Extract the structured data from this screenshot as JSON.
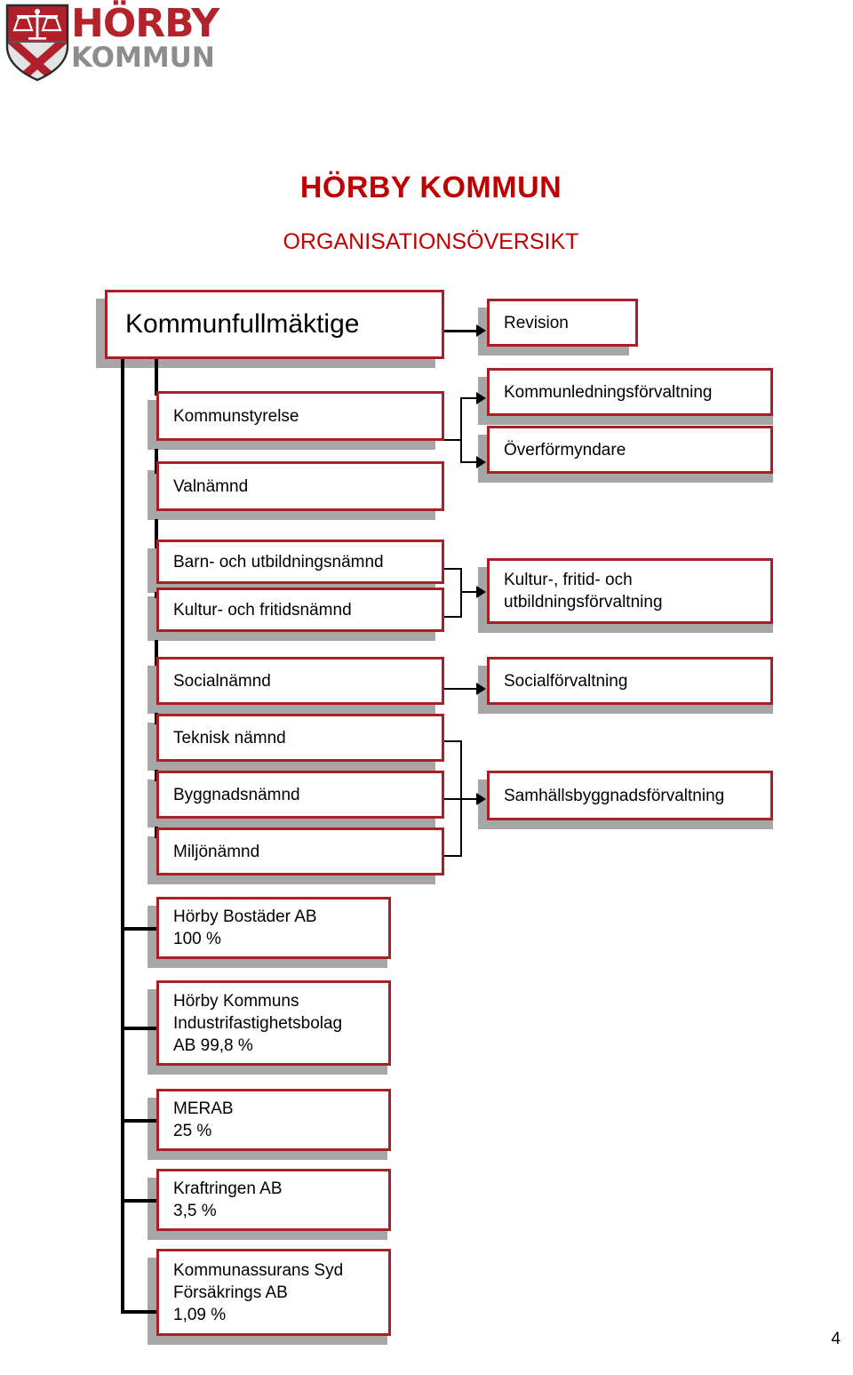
{
  "logo": {
    "name_top": "HÖRBY",
    "name_bottom": "KOMMUN",
    "icon": "coat-of-arms-shield-icon"
  },
  "header": {
    "title": "HÖRBY KOMMUN",
    "subtitle": "ORGANISATIONSÖVERSIKT"
  },
  "page": {
    "number": "4"
  },
  "colors": {
    "brand_red": "#c00000",
    "border_red": "#a81f26",
    "shadow_gray": "#a6a6a6",
    "logo_gray": "#8d8d8d"
  },
  "chart_data": {
    "type": "diagram",
    "title": "HÖRBY KOMMUN ORGANISATIONSÖVERSIKT",
    "nodes": [
      {
        "id": "kf",
        "label": "Kommunfullmäktige",
        "column": "left",
        "level": 0
      },
      {
        "id": "rev",
        "label": "Revision",
        "column": "right",
        "level": 0
      },
      {
        "id": "ks",
        "label": "Kommunstyrelse",
        "column": "left",
        "level": 1
      },
      {
        "id": "klf",
        "label": "Kommunledningsförvaltning",
        "column": "right",
        "level": 1
      },
      {
        "id": "ofm",
        "label": "Överförmyndare",
        "column": "right",
        "level": 1
      },
      {
        "id": "valn",
        "label": "Valnämnd",
        "column": "left",
        "level": 2
      },
      {
        "id": "bun",
        "label": "Barn- och utbildningsnämnd",
        "column": "left",
        "level": 3
      },
      {
        "id": "kfn",
        "label": "Kultur- och fritidsnämnd",
        "column": "left",
        "level": 4
      },
      {
        "id": "kfuf",
        "label": "Kultur-, fritid- och utbildningsförvaltning",
        "column": "right",
        "level": 3
      },
      {
        "id": "socn",
        "label": "Socialnämnd",
        "column": "left",
        "level": 5
      },
      {
        "id": "socf",
        "label": "Socialförvaltning",
        "column": "right",
        "level": 5
      },
      {
        "id": "tekn",
        "label": "Teknisk nämnd",
        "column": "left",
        "level": 6
      },
      {
        "id": "bygg",
        "label": "Byggnadsnämnd",
        "column": "left",
        "level": 7
      },
      {
        "id": "miljo",
        "label": "Miljönämnd",
        "column": "left",
        "level": 8
      },
      {
        "id": "sbf",
        "label": "Samhällsbyggnadsförvaltning",
        "column": "right",
        "level": 7
      },
      {
        "id": "hba",
        "label": "Hörby Bostäder AB\n100 %",
        "column": "sub",
        "level": 9
      },
      {
        "id": "hkif",
        "label": "Hörby Kommuns\nIndustrifastighetsbolag\nAB 99,8 %",
        "column": "sub",
        "level": 10
      },
      {
        "id": "merab",
        "label": "MERAB\n25 %",
        "column": "sub",
        "level": 11
      },
      {
        "id": "kraft",
        "label": "Kraftringen AB\n3,5 %",
        "column": "sub",
        "level": 12
      },
      {
        "id": "kass",
        "label": "Kommunassurans Syd\nFörsäkrings AB\n1,09 %",
        "column": "sub",
        "level": 13
      }
    ],
    "edges": [
      {
        "from": "kf",
        "to": "rev",
        "arrow": true
      },
      {
        "from": "kf",
        "to": "ks",
        "arrow": false
      },
      {
        "from": "kf",
        "to": "valn",
        "arrow": false
      },
      {
        "from": "kf",
        "to": "bun",
        "arrow": false
      },
      {
        "from": "kf",
        "to": "kfn",
        "arrow": false
      },
      {
        "from": "kf",
        "to": "socn",
        "arrow": false
      },
      {
        "from": "kf",
        "to": "tekn",
        "arrow": false
      },
      {
        "from": "kf",
        "to": "bygg",
        "arrow": false
      },
      {
        "from": "kf",
        "to": "miljo",
        "arrow": false
      },
      {
        "from": "ks",
        "to": "klf",
        "arrow": true
      },
      {
        "from": "ks",
        "to": "ofm",
        "arrow": true
      },
      {
        "from": "bun",
        "to": "kfuf",
        "arrow": true
      },
      {
        "from": "kfn",
        "to": "kfuf",
        "arrow": true
      },
      {
        "from": "socn",
        "to": "socf",
        "arrow": true
      },
      {
        "from": "tekn",
        "to": "sbf",
        "arrow": true
      },
      {
        "from": "bygg",
        "to": "sbf",
        "arrow": true
      },
      {
        "from": "miljo",
        "to": "sbf",
        "arrow": true
      },
      {
        "from": "kf",
        "to": "hba",
        "arrow": false
      },
      {
        "from": "kf",
        "to": "hkif",
        "arrow": false
      },
      {
        "from": "kf",
        "to": "merab",
        "arrow": false
      },
      {
        "from": "kf",
        "to": "kraft",
        "arrow": false
      },
      {
        "from": "kf",
        "to": "kass",
        "arrow": false
      }
    ]
  },
  "nodes": {
    "kf": "Kommunfullmäktige",
    "rev": "Revision",
    "ks": "Kommunstyrelse",
    "klf": "Kommunledningsförvaltning",
    "ofm": "Överförmyndare",
    "valn": "Valnämnd",
    "bun": "Barn- och utbildningsnämnd",
    "kfn": "Kultur- och fritidsnämnd",
    "kfuf": "Kultur-, fritid- och utbildningsförvaltning",
    "socn": "Socialnämnd",
    "socf": "Socialförvaltning",
    "tekn": "Teknisk nämnd",
    "bygg": "Byggnadsnämnd",
    "miljo": "Miljönämnd",
    "sbf": "Samhällsbyggnadsförvaltning",
    "hba_l1": "Hörby Bostäder AB",
    "hba_l2": "100 %",
    "hkif_l1": "Hörby Kommuns",
    "hkif_l2": "Industrifastighetsbolag",
    "hkif_l3": "AB 99,8 %",
    "merab_l1": "MERAB",
    "merab_l2": "25 %",
    "kraft_l1": "Kraftringen AB",
    "kraft_l2": "3,5 %",
    "kass_l1": "Kommunassurans Syd",
    "kass_l2": "Försäkrings AB",
    "kass_l3": "1,09 %"
  }
}
